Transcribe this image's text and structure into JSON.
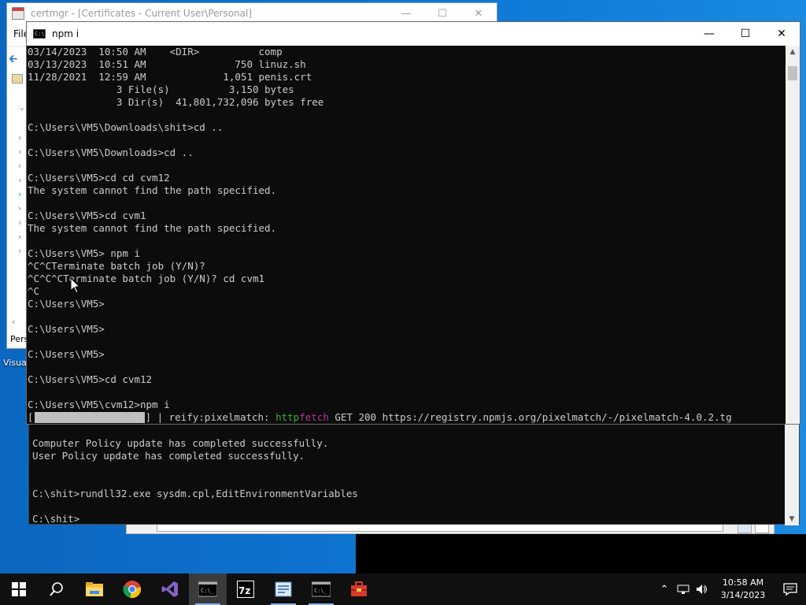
{
  "certmgr": {
    "title": "certmgr - [Certificates - Current User\\Personal]",
    "menu_first": "File",
    "status_partial": "Pers"
  },
  "desktop": {
    "icon_label": "Visua"
  },
  "cmd": {
    "title": "npm i",
    "lines": [
      "03/14/2023  10:50 AM    <DIR>          comp",
      "03/13/2023  10:51 AM               750 linuz.sh",
      "11/28/2021  12:59 AM             1,051 penis.crt",
      "               3 File(s)          3,150 bytes",
      "               3 Dir(s)  41,801,732,096 bytes free",
      "",
      "C:\\Users\\VM5\\Downloads\\shit>cd ..",
      "",
      "C:\\Users\\VM5\\Downloads>cd ..",
      "",
      "C:\\Users\\VM5>cd cd cvm12",
      "The system cannot find the path specified.",
      "",
      "C:\\Users\\VM5>cd cvm1",
      "The system cannot find the path specified.",
      "",
      "C:\\Users\\VM5> npm i",
      "^C^CTerminate batch job (Y/N)?",
      "^C^C^CTerminate batch job (Y/N)? cd cvm1",
      "^C",
      "C:\\Users\\VM5>",
      "",
      "C:\\Users\\VM5>",
      "",
      "C:\\Users\\VM5>",
      "",
      "C:\\Users\\VM5>cd cvm12",
      "",
      "C:\\Users\\VM5\\cvm12>npm i"
    ],
    "progress": {
      "open": "[",
      "close": "] | reify:pixelmatch: ",
      "http": "http",
      "fetch": "fetch",
      "rest": " GET 200 https://registry.npmjs.org/pixelmatch/-/pixelmatch-4.0.2.tg"
    }
  },
  "console2": {
    "lines": [
      "Computer Policy update has completed successfully.",
      "User Policy update has completed successfully.",
      "",
      "",
      "C:\\shit>rundll32.exe sysdm.cpl,EditEnvironmentVariables",
      "",
      "C:\\shit>"
    ]
  },
  "taskbar": {
    "clock_time": "10:58 AM",
    "clock_date": "3/14/2023",
    "apps": [
      "start-icon",
      "search-icon",
      "file-explorer-icon",
      "chrome-icon",
      "visual-studio-icon",
      "cmd-icon",
      "7zip-icon",
      "certmgr-icon",
      "cmd-icon",
      "toolbox-icon"
    ]
  },
  "colors": {
    "terminal_bg": "#0c0c0c",
    "terminal_fg": "#cccccc",
    "http_green": "#3fa83f",
    "fetch_magenta": "#b0379b",
    "taskbar_bg": "#101010"
  }
}
